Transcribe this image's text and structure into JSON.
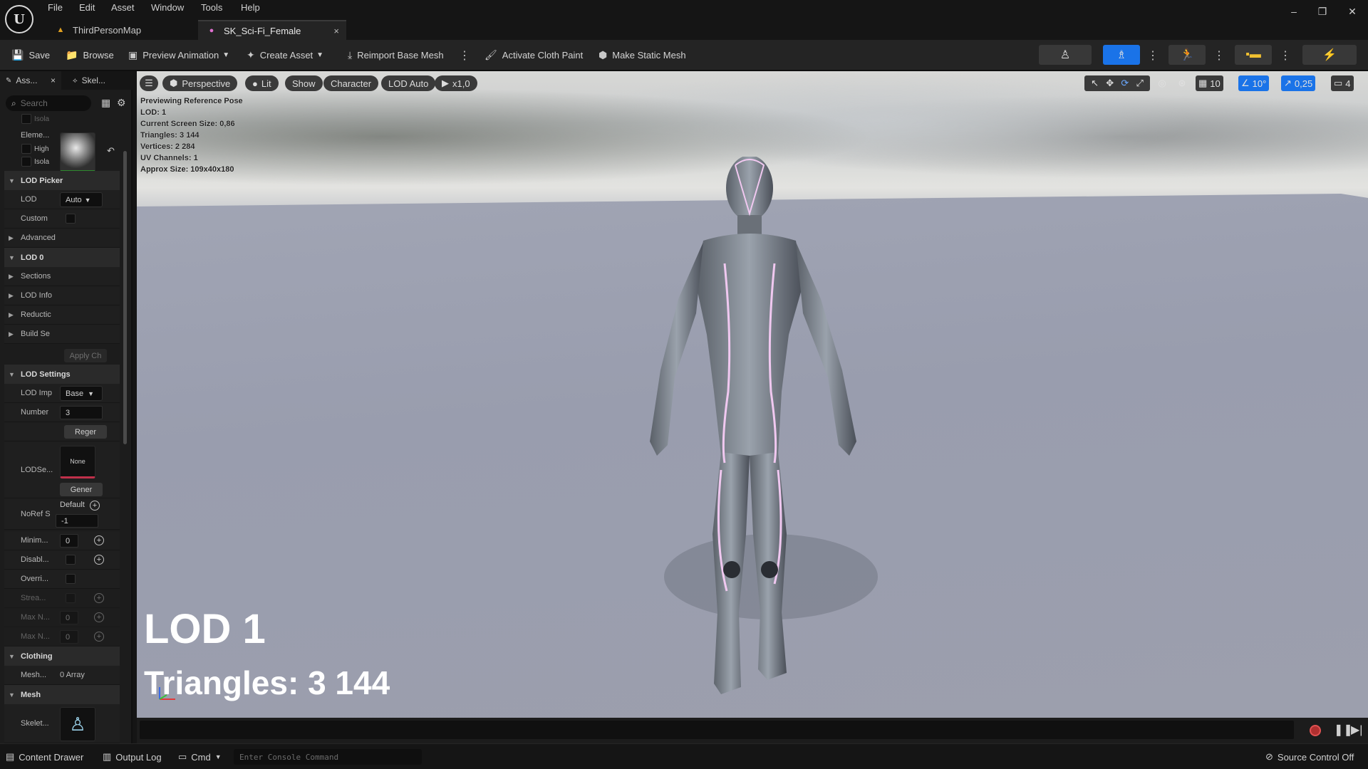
{
  "menu": {
    "items": [
      "File",
      "Edit",
      "Asset",
      "Window",
      "Tools",
      "Help"
    ]
  },
  "tabs": [
    {
      "label": "ThirdPersonMap",
      "icon": "level-icon"
    },
    {
      "label": "SK_Sci-Fi_Female",
      "icon": "skeletal-mesh-icon",
      "close": "×"
    }
  ],
  "window_controls": {
    "minimize": "–",
    "restore": "❐",
    "close": "✕"
  },
  "toolbar": {
    "save": "Save",
    "browse": "Browse",
    "preview_animation": "Preview Animation",
    "create_asset": "Create Asset",
    "reimport": "Reimport Base Mesh",
    "activate_cloth": "Activate Cloth Paint",
    "make_static": "Make Static Mesh"
  },
  "left_panel": {
    "tab1": "Ass...",
    "tab1_close": "×",
    "tab2": "Skel...",
    "search_placeholder": "Search",
    "row_isolate_top": "Isola",
    "element_label": "Eleme...",
    "highlight_label": "High",
    "isolate_label": "Isola",
    "lod_picker": "LOD Picker",
    "lod_label": "LOD",
    "lod_value": "Auto",
    "custom_label": "Custom",
    "advanced": "Advanced",
    "lod0": "LOD 0",
    "sections": "Sections",
    "lod_info": "LOD Info",
    "reduction": "Reductic",
    "build_settings": "Build Se",
    "apply_changes": "Apply Ch",
    "lod_settings": "LOD Settings",
    "lod_import": "LOD Imp",
    "lod_import_value": "Base",
    "number_label": "Number",
    "number_value": "3",
    "regen_btn": "Reger",
    "lodsettings_label": "LODSe...",
    "lodsettings_thumb": "None",
    "generate_btn": "Gener",
    "noref_label": "NoRef S",
    "noref_default": "Default",
    "noref_value": "-1",
    "minimum_label": "Minim...",
    "minimum_value": "0",
    "disable_label": "Disabl...",
    "override_label": "Overri...",
    "stream_label": "Strea...",
    "maxn1_label": "Max N...",
    "maxn1_value": "0",
    "maxn2_label": "Max N...",
    "maxn2_value": "0",
    "clothing": "Clothing",
    "mesh_label": "Mesh...",
    "mesh_value": "0 Array",
    "mesh_section": "Mesh",
    "skeleton_label": "Skelet..."
  },
  "viewport": {
    "perspective": "Perspective",
    "lit": "Lit",
    "show": "Show",
    "character": "Character",
    "lod_auto": "LOD Auto",
    "play_speed": "x1,0",
    "grid_size": "10",
    "rot_snap": "10°",
    "scale_snap": "0,25",
    "camera_speed": "4",
    "stats": [
      "Previewing Reference Pose",
      "LOD: 1",
      "Current Screen Size: 0,86",
      "Triangles: 3 144",
      "Vertices: 2 284",
      "UV Channels: 1",
      "Approx Size: 109x40x180"
    ],
    "big_lod": "LOD 1",
    "big_triangles": "Triangles: 3 144"
  },
  "statusbar": {
    "content_drawer": "Content Drawer",
    "output_log": "Output Log",
    "cmd": "Cmd",
    "console_placeholder": "Enter Console Command",
    "source_control": "Source Control Off"
  },
  "colors": {
    "accent_blue": "#1a73e8",
    "record_red": "#b03030"
  }
}
